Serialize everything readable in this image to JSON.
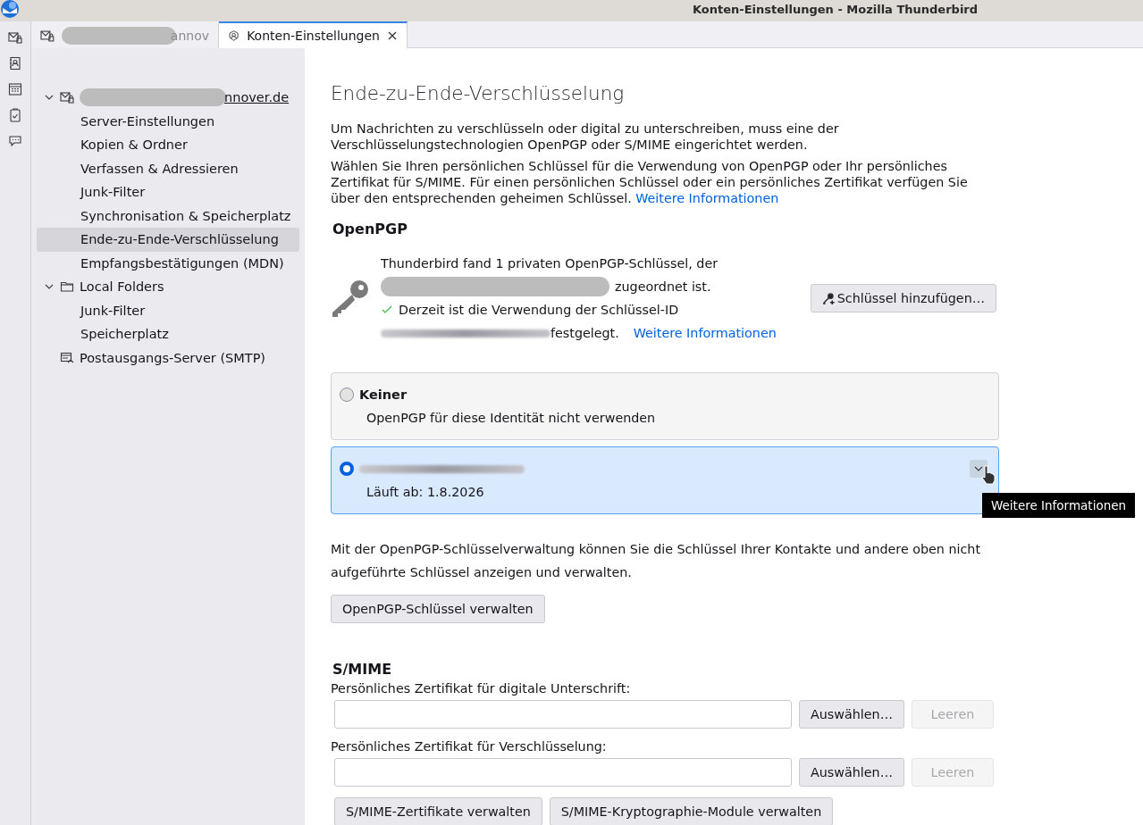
{
  "window": {
    "title": "Konten-Einstellungen - Mozilla Thunderbird"
  },
  "tabs": [
    {
      "label": "annov",
      "kind": "mail",
      "selected": false
    },
    {
      "label": "Konten-Einstellungen",
      "kind": "settings",
      "selected": true
    }
  ],
  "sidebar": {
    "items": [
      {
        "label": "nnover.de",
        "kind": "account",
        "expanded": true,
        "selected": false,
        "children": [
          {
            "label": "Server-Einstellungen",
            "selected": false
          },
          {
            "label": "Kopien & Ordner",
            "selected": false
          },
          {
            "label": "Verfassen & Adressieren",
            "selected": false
          },
          {
            "label": "Junk-Filter",
            "selected": false
          },
          {
            "label": "Synchronisation & Speicherplatz",
            "selected": false
          },
          {
            "label": "Ende-zu-Ende-Verschlüsselung",
            "selected": true
          },
          {
            "label": "Empfangsbestätigungen (MDN)",
            "selected": false
          }
        ]
      },
      {
        "label": "Local Folders",
        "kind": "folder",
        "expanded": true,
        "selected": false,
        "children": [
          {
            "label": "Junk-Filter",
            "selected": false
          },
          {
            "label": "Speicherplatz",
            "selected": false
          }
        ]
      },
      {
        "label": "Postausgangs-Server (SMTP)",
        "kind": "smtp",
        "selected": false
      }
    ]
  },
  "content": {
    "heading": "Ende-zu-Ende-Verschlüsselung",
    "intro": [
      "Um Nachrichten zu verschlüsseln oder digital zu unterschreiben, muss eine der Verschlüsselungstechnologien OpenPGP oder S/MIME eingerichtet werden.",
      "Wählen Sie Ihren persönlichen Schlüssel für die Verwendung von OpenPGP oder Ihr persönliches Zertifikat für S/MIME. Für einen persönlichen Schlüssel oder ein persönliches Zertifikat verfügen Sie über den entsprechenden geheimen Schlüssel."
    ],
    "intro_link": "Weitere Informationen",
    "openpgp": {
      "title": "OpenPGP",
      "found_line": "Thunderbird fand 1 privaten OpenPGP-Schlüssel, der",
      "assigned_line": "zugeordnet ist.",
      "status_line": "Derzeit ist die Verwendung der Schlüssel-ID",
      "fixed_line": "festgelegt.",
      "link": "Weitere Informationen",
      "add_button": "Schlüssel hinzufügen…",
      "options": [
        {
          "kind": "none",
          "title": "Keiner",
          "description": "OpenPGP für diese Identität nicht verwenden",
          "selected": false
        },
        {
          "kind": "key",
          "description": "Läuft ab: 1.8.2026",
          "selected": true
        }
      ],
      "manage_text": "Mit der OpenPGP-Schlüsselverwaltung können Sie die Schlüssel Ihrer Kontakte und andere oben nicht aufgeführte Schlüssel anzeigen und verwalten.",
      "manage_button": "OpenPGP-Schlüssel verwalten"
    },
    "smime": {
      "title": "S/MIME",
      "fields": [
        {
          "label": "Persönliches Zertifikat für digitale Unterschrift:",
          "select_button": "Auswählen…",
          "clear_button": "Leeren",
          "clear_disabled": true
        },
        {
          "label": "Persönliches Zertifikat für Verschlüsselung:",
          "select_button": "Auswählen…",
          "clear_button": "Leeren",
          "clear_disabled": true
        }
      ],
      "buttons": [
        "S/MIME-Zertifikate verwalten",
        "S/MIME-Kryptographie-Module verwalten"
      ]
    }
  },
  "tooltip": "Weitere Informationen"
}
